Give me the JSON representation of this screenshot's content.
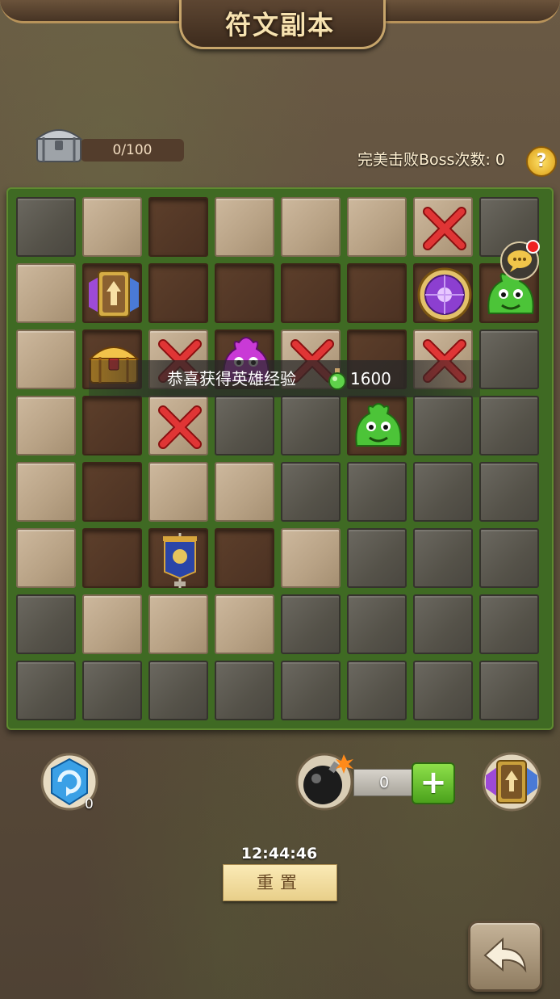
{
  "header": {
    "title": "符文副本"
  },
  "chest_counter": {
    "value": "0/100",
    "icon": "silver-chest-icon"
  },
  "boss": {
    "label": "完美击败Boss次数: 0"
  },
  "help": {
    "label": "?"
  },
  "board": {
    "rows": 8,
    "cols": 8,
    "tiles": [
      [
        "stone",
        "open",
        "dirt",
        "open",
        "open",
        "open",
        "open:cross",
        "stone"
      ],
      [
        "open",
        "dirt:rune-card",
        "dirt",
        "dirt",
        "dirt",
        "dirt",
        "dirt:purple-orb",
        "dirt:green-slime"
      ],
      [
        "open",
        "dirt:golden-chest",
        "open:cross",
        "dirt:purple-slime",
        "open:cross",
        "dirt",
        "open:cross",
        "stone"
      ],
      [
        "open",
        "dirt",
        "open:cross",
        "stone",
        "stone",
        "dirt:green-slime",
        "stone",
        "stone"
      ],
      [
        "open",
        "dirt",
        "open",
        "open",
        "stone",
        "stone",
        "stone",
        "stone"
      ],
      [
        "open",
        "dirt",
        "dirt:blue-banner",
        "dirt",
        "open",
        "stone",
        "stone",
        "stone"
      ],
      [
        "stone",
        "open",
        "open",
        "open",
        "stone",
        "stone",
        "stone",
        "stone"
      ],
      [
        "stone",
        "stone",
        "stone",
        "stone",
        "stone",
        "stone",
        "stone",
        "stone"
      ]
    ]
  },
  "message": {
    "text": "恭喜获得英雄经验",
    "value": "1600",
    "icon": "green-potion-icon"
  },
  "chat": {
    "icon": "chat-bubble-icon"
  },
  "refresh": {
    "count": "0",
    "icon": "blue-refresh-crystal-icon"
  },
  "bomb": {
    "count": "0",
    "icon": "bomb-icon",
    "add_label": "+"
  },
  "card": {
    "icon": "rune-card-icon"
  },
  "timer": {
    "text": "12:44:46"
  },
  "reset": {
    "label": "重置"
  },
  "back": {
    "icon": "back-arrow-icon"
  }
}
